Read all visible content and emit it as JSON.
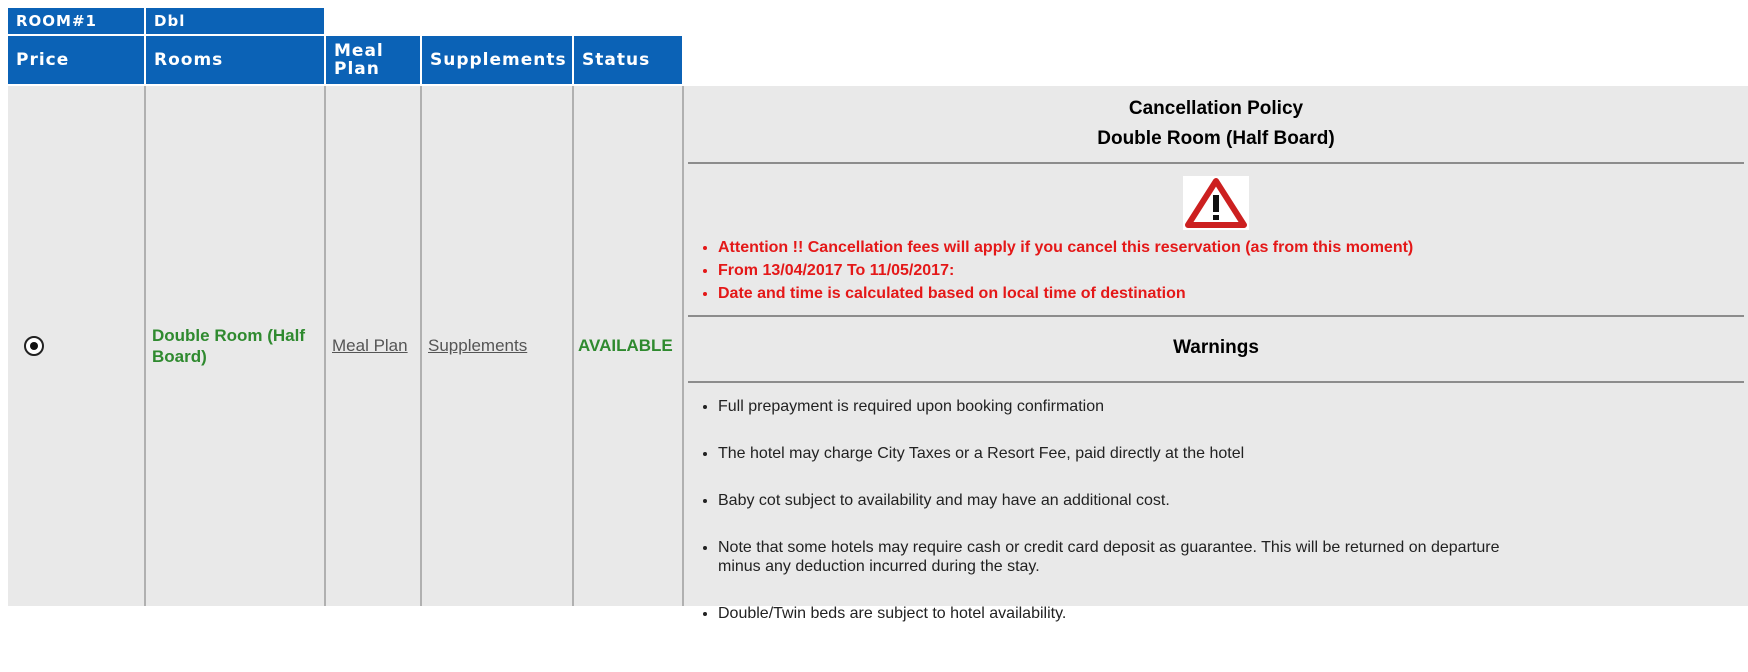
{
  "room_header": {
    "room_label": "ROOM#1",
    "room_type": "Dbl"
  },
  "columns": {
    "price": "Price",
    "rooms": "Rooms",
    "meal_plan": "Meal Plan",
    "supplements": "Supplements",
    "status": "Status"
  },
  "row": {
    "room_name": "Double Room (Half Board)",
    "meal_plan_link": "Meal Plan",
    "supplements_link": "Supplements",
    "status": "AVAILABLE",
    "price_selected": true
  },
  "policy": {
    "title": "Cancellation Policy",
    "subtitle": "Double Room (Half Board)",
    "icon": "warning-triangle-icon",
    "alerts": [
      "Attention !! Cancellation fees will apply if you cancel this reservation (as from this moment)",
      "From 13/04/2017 To 11/05/2017:",
      "Date and time is calculated based on local time of destination"
    ],
    "warnings_title": "Warnings",
    "warnings": [
      "Full prepayment is required upon booking confirmation",
      "The hotel may charge City Taxes or a Resort Fee, paid directly at the hotel",
      "Baby cot subject to availability and may have an additional cost.",
      "Note that some hotels may require cash or credit card deposit as guarantee. This will be returned on departure minus any deduction incurred during the stay.",
      "Double/Twin beds are subject to hotel availability."
    ]
  },
  "colors": {
    "header_bg": "#0b62b6",
    "cell_bg": "#e9e9e9",
    "available": "#2f8a2f",
    "alert": "#e41818"
  }
}
